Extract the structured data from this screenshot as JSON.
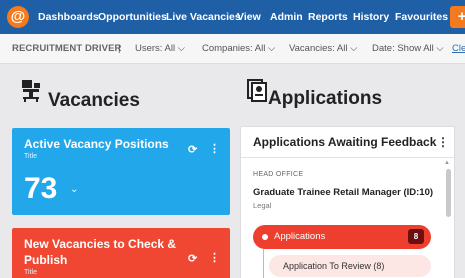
{
  "nav": {
    "logo_glyph": "@",
    "items": [
      "Dashboards",
      "Opportunities",
      "Live Vacancies",
      "View",
      "Admin",
      "Reports",
      "History",
      "Favourites"
    ],
    "plus_label": "+",
    "colors": {
      "bar": "#1f5fa6",
      "accent": "#f47a20"
    }
  },
  "filters": {
    "recruitment_driver": "RECRUITMENT DRIVER",
    "divider": "|",
    "users": "Users: All ⌵",
    "companies": "Companies: All ⌵",
    "vacancies": "Vacancies: All ⌵",
    "date": "Date: Show All ⌵",
    "clear": "Cle"
  },
  "vacancies_section": {
    "title": "Vacancies",
    "icon": "desk-chair-icon",
    "cards": [
      {
        "title": "Active Vacancy Positions",
        "subtitle": "Title",
        "value": "73",
        "chevron": "⌄",
        "refresh": "⟳",
        "menu": "⋮",
        "color": "#22a7ea"
      },
      {
        "title": "New Vacancies to Check & Publish",
        "subtitle": "Title",
        "refresh": "⟳",
        "menu": "⋮",
        "color": "#f04732"
      }
    ]
  },
  "applications_section": {
    "title": "Applications",
    "icon": "document-stack-icon",
    "panel": {
      "title": "Applications Awaiting Feedback",
      "menu": "⋮",
      "office": "HEAD OFFICE",
      "job_title": "Graduate Trainee Retail Manager (ID:10)",
      "department": "Legal",
      "applications_label": "Applications",
      "applications_count": "8",
      "review_label": "Application To Review (8)"
    }
  }
}
